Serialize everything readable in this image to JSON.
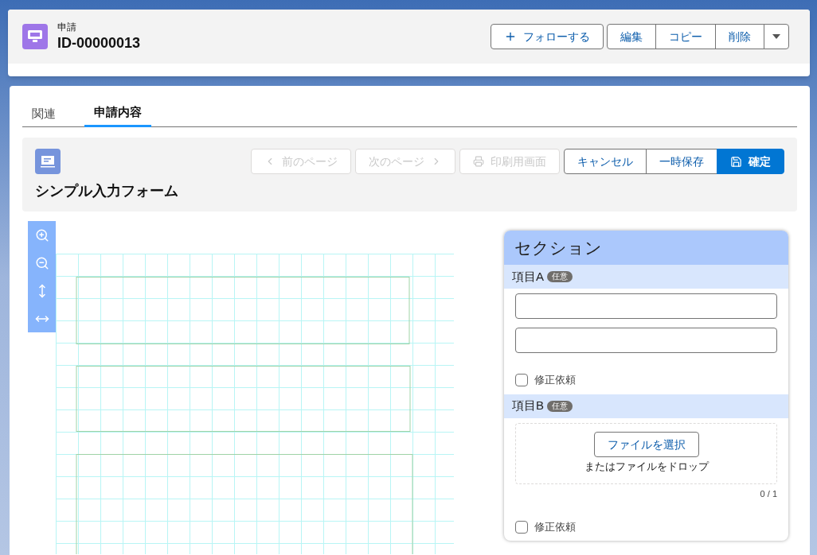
{
  "record": {
    "type_label": "申請",
    "id": "ID-00000013",
    "follow_button": "フォローする",
    "actions": [
      "編集",
      "コピー",
      "削除"
    ]
  },
  "tabs": [
    {
      "label": "関連",
      "selected": false
    },
    {
      "label": "申請内容",
      "selected": true
    }
  ],
  "form": {
    "title": "シンプル入力フォーム",
    "buttons": [
      {
        "label": "前のページ",
        "kind": "prev",
        "disabled": true
      },
      {
        "label": "次のページ",
        "kind": "next",
        "disabled": true
      },
      {
        "label": "印刷用画面",
        "kind": "print",
        "disabled": true
      }
    ],
    "actions": [
      {
        "label": "キャンセル",
        "kind": "plain"
      },
      {
        "label": "一時保存",
        "kind": "plain"
      },
      {
        "label": "確定",
        "kind": "primary"
      }
    ]
  },
  "section": {
    "title": "セクション",
    "items": [
      {
        "label": "項目A",
        "badge": "任意",
        "kind": "text",
        "inputs": [
          {
            "kind": "text"
          },
          {
            "kind": "text"
          }
        ],
        "correction": {
          "label": "修正依頼",
          "checked": false
        }
      },
      {
        "label": "項目B",
        "badge": "任意",
        "kind": "file",
        "file_button": "ファイルを選択",
        "drop_text": "またはファイルをドロップ",
        "count": "0 / 1",
        "correction": {
          "label": "修正依頼",
          "checked": false
        }
      }
    ]
  }
}
